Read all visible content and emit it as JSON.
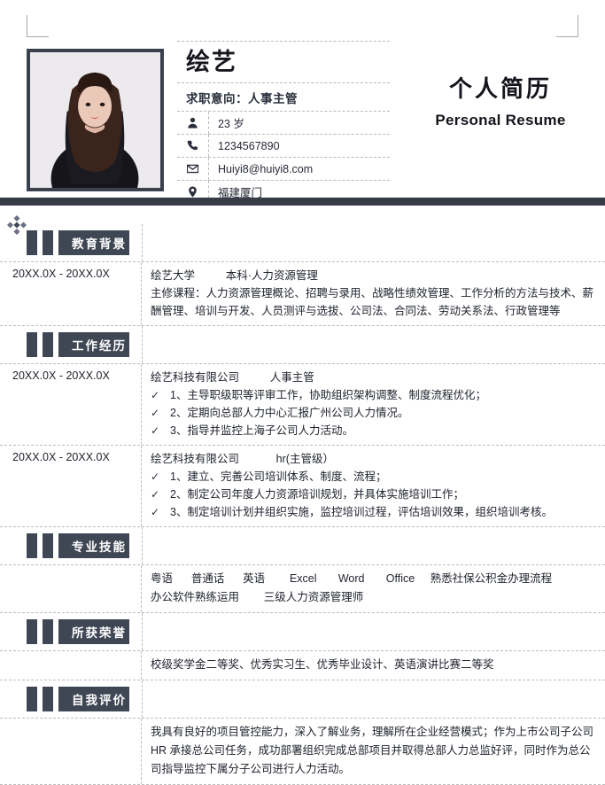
{
  "document": {
    "title_cn": "个人简历",
    "title_en": "Personal Resume"
  },
  "profile": {
    "name": "绘艺",
    "objective": "求职意向：人事主管",
    "contacts": [
      {
        "icon": "person-icon",
        "value": "23 岁"
      },
      {
        "icon": "phone-icon",
        "value": "1234567890"
      },
      {
        "icon": "envelope-icon",
        "value": "Huiyi8@huiyi8.com"
      },
      {
        "icon": "location-pin-icon",
        "value": "福建厦门"
      }
    ]
  },
  "sections": [
    {
      "key": "education",
      "label": "教育背景",
      "entries": [
        {
          "date": "20XX.0X - 20XX.0X",
          "heading": "绘艺大学          本科·人力资源管理",
          "paragraph": "主修课程：人力资源管理概论、招聘与录用、战略性绩效管理、工作分析的方法与技术、薪酬管理、培训与开发、人员测评与选拔、公司法、合同法、劳动关系法、行政管理等"
        }
      ]
    },
    {
      "key": "work-experience",
      "label": "工作经历",
      "entries": [
        {
          "date": "20XX.0X - 20XX.0X",
          "heading": "绘艺科技有限公司          人事主管",
          "bullets": [
            "1、主导职级职等评审工作，协助组织架构调整、制度流程优化；",
            "2、定期向总部人力中心汇报广州公司人力情况。",
            "3、指导并监控上海子公司人力活动。"
          ]
        },
        {
          "date": "20XX.0X - 20XX.0X",
          "heading": "绘艺科技有限公司            hr(主管级）",
          "bullets": [
            "1、建立、完善公司培训体系、制度、流程；",
            "2、制定公司年度人力资源培训规划，并具体实施培训工作；",
            "3、制定培训计划并组织实施，监控培训过程，评估培训效果，组织培训考核。"
          ]
        }
      ]
    },
    {
      "key": "skills",
      "label": "专业技能",
      "entries": [
        {
          "date": "",
          "lines": [
            "粤语      普通话      英语        Excel       Word       Office     熟悉社保公积金办理流程",
            "办公软件熟练运用        三级人力资源管理师"
          ]
        }
      ]
    },
    {
      "key": "honors",
      "label": "所获荣誉",
      "entries": [
        {
          "date": "",
          "lines": [
            "校级奖学金二等奖、优秀实习生、优秀毕业设计、英语演讲比赛二等奖"
          ]
        }
      ]
    },
    {
      "key": "self-evaluation",
      "label": "自我评价",
      "entries": [
        {
          "date": "",
          "evaluation": "我具有良好的项目管控能力，深入了解业务，理解所在企业经营模式；作为上市公司子公司HR 承接总公司任务，成功部署组织完成总部项目并取得总部人力总监好评，同时作为总公司指导监控下属分子公司进行人力活动。"
        }
      ]
    }
  ],
  "colors": {
    "accent_dark": "#3f4654",
    "rule": "#373c47",
    "text": "#20242e"
  },
  "bullet_glyph": "✓"
}
